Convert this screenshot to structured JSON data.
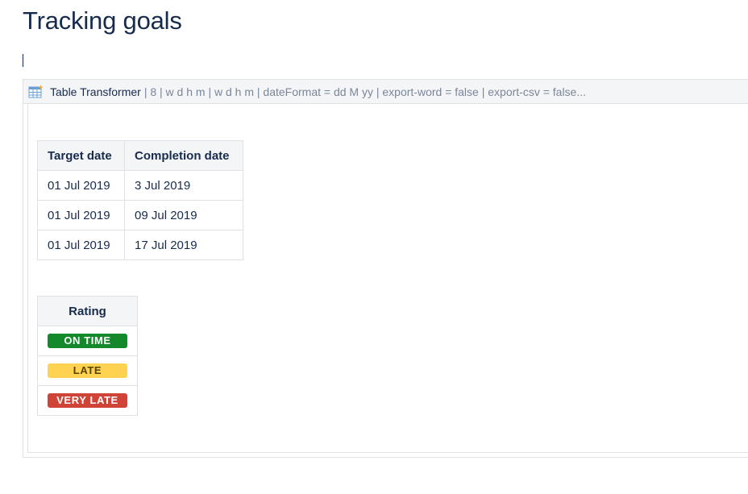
{
  "page": {
    "title": "Tracking goals"
  },
  "macro": {
    "icon": "table-transformer-icon",
    "name": "Table Transformer",
    "params": "| 8 | w d h m | w d h m | dateFormat = dd M yy | export-word = false | export-csv = false..."
  },
  "dates_table": {
    "headers": [
      "Target date",
      "Completion date"
    ],
    "rows": [
      [
        "01 Jul 2019",
        "3 Jul 2019"
      ],
      [
        "01 Jul 2019",
        "09 Jul 2019"
      ],
      [
        "01 Jul 2019",
        "17 Jul 2019"
      ]
    ]
  },
  "rating_table": {
    "header": "Rating",
    "rows": [
      {
        "label": "ON TIME",
        "bg": "#14892c",
        "fg": "#ffffff"
      },
      {
        "label": "LATE",
        "bg": "#ffd351",
        "fg": "#594300"
      },
      {
        "label": "VERY LATE",
        "bg": "#d04437",
        "fg": "#ffffff"
      }
    ]
  }
}
